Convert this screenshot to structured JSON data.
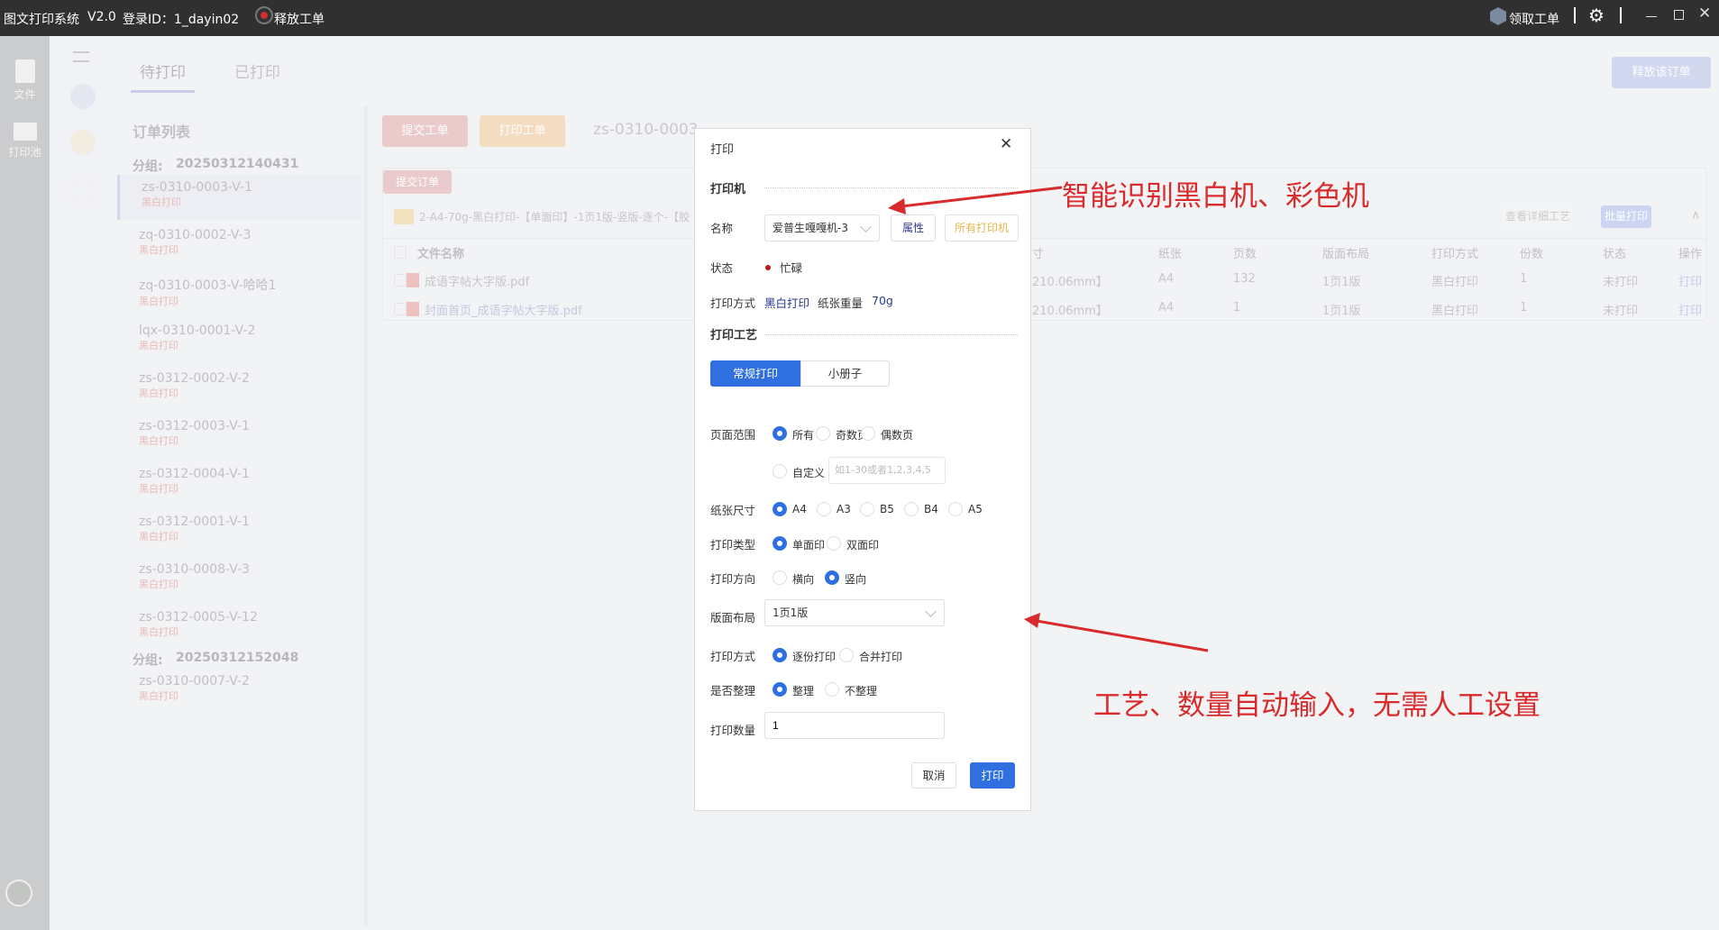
{
  "titlebar": {
    "app": "图文打印系统",
    "version": "V2.0",
    "login": "登录ID：1_dayin02",
    "release": "释放工单",
    "claim": "领取工单"
  },
  "rail": [
    {
      "label": "文件"
    },
    {
      "label": "打印池"
    }
  ],
  "tabs": [
    {
      "label": "待打印"
    },
    {
      "label": "已打印"
    }
  ],
  "release_order": "释放该订单",
  "orders": {
    "title": "订单列表",
    "groups": [
      {
        "label": "分组:",
        "id": "20250312140431",
        "items": [
          {
            "name": "zs-0310-0003-V-1",
            "mode": "黑白打印"
          },
          {
            "name": "zq-0310-0002-V-3",
            "mode": "黑白打印"
          },
          {
            "name": "zq-0310-0003-V-哈哈1",
            "mode": "黑白打印"
          },
          {
            "name": "lqx-0310-0001-V-2",
            "mode": "黑白打印"
          },
          {
            "name": "zs-0312-0002-V-2",
            "mode": "黑白打印"
          },
          {
            "name": "zs-0312-0003-V-1",
            "mode": "黑白打印"
          },
          {
            "name": "zs-0312-0004-V-1",
            "mode": "黑白打印"
          },
          {
            "name": "zs-0312-0001-V-1",
            "mode": "黑白打印"
          },
          {
            "name": "zs-0310-0008-V-3",
            "mode": "黑白打印"
          },
          {
            "name": "zs-0312-0005-V-12",
            "mode": "黑白打印"
          }
        ]
      },
      {
        "label": "分组:",
        "id": "20250312152048",
        "items": [
          {
            "name": "zs-0310-0007-V-2",
            "mode": "黑白打印"
          }
        ]
      }
    ]
  },
  "main": {
    "submit_ticket": "提交工单",
    "print_ticket": "打印工单",
    "order_id": "zs-0310-0003-",
    "submit_order": "提交订单",
    "folder": "2-A4-70g-黑白打印-【单面印】-1页1版-竖版-逐个-【胶",
    "view_detail": "查看详细工艺",
    "batch_print": "批量打印",
    "headers": [
      "文件名称",
      "寸",
      "纸张",
      "页数",
      "版面布局",
      "打印方式",
      "份数",
      "状态",
      "操作"
    ],
    "rows": [
      {
        "file": "成语字帖大字版.pdf",
        "size": "210.06mm】",
        "paper": "A4",
        "pages": "132",
        "layout": "1页1版",
        "mode": "黑白打印",
        "copies": "1",
        "status": "未打印",
        "action": "打印"
      },
      {
        "file": "封面首页_成语字帖大字版.pdf",
        "size": "210.06mm】",
        "paper": "A4",
        "pages": "1",
        "layout": "1页1版",
        "mode": "黑白打印",
        "copies": "1",
        "status": "未打印",
        "action": "打印"
      }
    ]
  },
  "dialog": {
    "title": "打印",
    "printer_section": "打印机",
    "name_label": "名称",
    "printer_name": "爱普生嘎嘎机-3",
    "props_btn": "属性",
    "all_printers_btn": "所有打印机",
    "status_label": "状态",
    "status_value": "忙碌",
    "mode_label": "打印方式",
    "mode_value": "黑白打印",
    "weight_label": "纸张重量",
    "weight_value": "70g",
    "craft_section": "打印工艺",
    "seg": [
      "常规打印",
      "小册子"
    ],
    "page_range_label": "页面范围",
    "page_range": [
      "所有",
      "奇数页",
      "偶数页"
    ],
    "custom": "自定义",
    "custom_placeholder": "如1-30或者1,2,3,4,5",
    "paper_label": "纸张尺寸",
    "paper": [
      "A4",
      "A3",
      "B5",
      "B4",
      "A5"
    ],
    "type_label": "打印类型",
    "type": [
      "单面印",
      "双面印"
    ],
    "orient_label": "打印方向",
    "orient": [
      "横向",
      "竖向"
    ],
    "layout_label": "版面布局",
    "layout_value": "1页1版",
    "way_label": "打印方式",
    "way": [
      "逐份打印",
      "合并打印"
    ],
    "collate_label": "是否整理",
    "collate": [
      "整理",
      "不整理"
    ],
    "qty_label": "打印数量",
    "qty_value": "1",
    "cancel": "取消",
    "print": "打印"
  },
  "annotations": {
    "a1": "智能识别黑白机、彩色机",
    "a2": "工艺、数量自动输入，无需人工设置"
  },
  "colors": {
    "accent": "#2f6fe0",
    "annotation": "#d92b2b"
  }
}
